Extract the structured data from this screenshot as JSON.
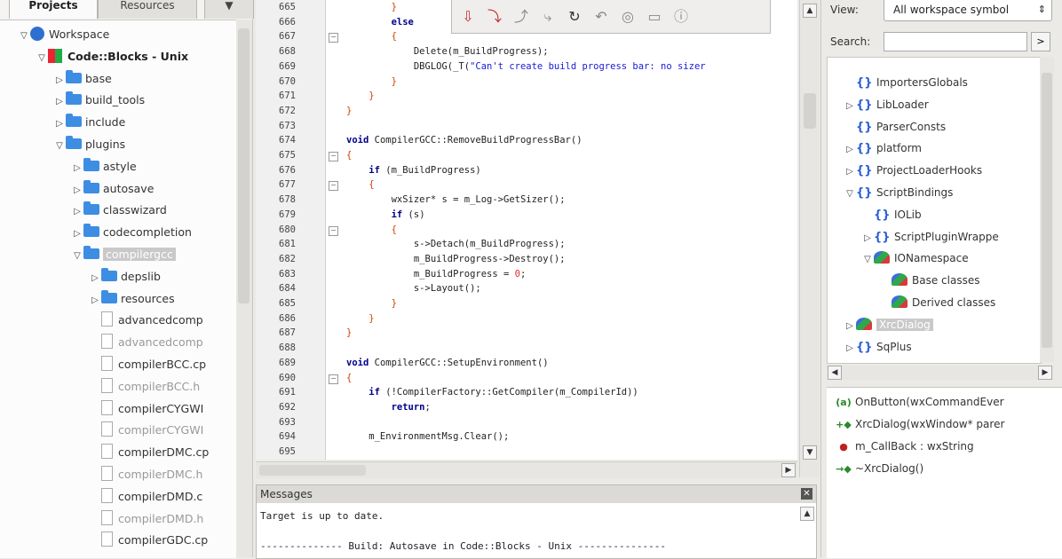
{
  "left_panel": {
    "tabs": [
      "Projects",
      "Resources"
    ],
    "tree": [
      {
        "label": "Workspace",
        "indent": 0,
        "arrow": "down",
        "icon": "workspace"
      },
      {
        "label": "Code::Blocks - Unix",
        "indent": 1,
        "arrow": "down",
        "icon": "project",
        "bold": true
      },
      {
        "label": "base",
        "indent": 2,
        "arrow": "right",
        "icon": "folder"
      },
      {
        "label": "build_tools",
        "indent": 2,
        "arrow": "right",
        "icon": "folder"
      },
      {
        "label": "include",
        "indent": 2,
        "arrow": "right",
        "icon": "folder"
      },
      {
        "label": "plugins",
        "indent": 2,
        "arrow": "down",
        "icon": "folder"
      },
      {
        "label": "astyle",
        "indent": 3,
        "arrow": "right",
        "icon": "folder"
      },
      {
        "label": "autosave",
        "indent": 3,
        "arrow": "right",
        "icon": "folder"
      },
      {
        "label": "classwizard",
        "indent": 3,
        "arrow": "right",
        "icon": "folder"
      },
      {
        "label": "codecompletion",
        "indent": 3,
        "arrow": "right",
        "icon": "folder"
      },
      {
        "label": "compilergcc",
        "indent": 3,
        "arrow": "down",
        "icon": "folder",
        "selected": true
      },
      {
        "label": "depslib",
        "indent": 4,
        "arrow": "right",
        "icon": "folder"
      },
      {
        "label": "resources",
        "indent": 4,
        "arrow": "right",
        "icon": "folder"
      },
      {
        "label": "advancedcomp",
        "indent": 4,
        "arrow": "",
        "icon": "file"
      },
      {
        "label": "advancedcomp",
        "indent": 4,
        "arrow": "",
        "icon": "file",
        "muted": true
      },
      {
        "label": "compilerBCC.cp",
        "indent": 4,
        "arrow": "",
        "icon": "file"
      },
      {
        "label": "compilerBCC.h",
        "indent": 4,
        "arrow": "",
        "icon": "file",
        "muted": true
      },
      {
        "label": "compilerCYGWI",
        "indent": 4,
        "arrow": "",
        "icon": "file"
      },
      {
        "label": "compilerCYGWI",
        "indent": 4,
        "arrow": "",
        "icon": "file",
        "muted": true
      },
      {
        "label": "compilerDMC.cp",
        "indent": 4,
        "arrow": "",
        "icon": "file"
      },
      {
        "label": "compilerDMC.h",
        "indent": 4,
        "arrow": "",
        "icon": "file",
        "muted": true
      },
      {
        "label": "compilerDMD.c",
        "indent": 4,
        "arrow": "",
        "icon": "file"
      },
      {
        "label": "compilerDMD.h",
        "indent": 4,
        "arrow": "",
        "icon": "file",
        "muted": true
      },
      {
        "label": "compilerGDC.cp",
        "indent": 4,
        "arrow": "",
        "icon": "file"
      }
    ]
  },
  "editor": {
    "lines": [
      {
        "n": "665",
        "fold": "",
        "code": [
          [
            "        ",
            ""
          ],
          [
            "}",
            "br"
          ]
        ]
      },
      {
        "n": "666",
        "fold": "",
        "code": [
          [
            "        ",
            ""
          ],
          [
            "else",
            "kw"
          ]
        ]
      },
      {
        "n": "667",
        "fold": "-",
        "code": [
          [
            "        ",
            ""
          ],
          [
            "{",
            "br"
          ]
        ]
      },
      {
        "n": "668",
        "fold": "",
        "code": [
          [
            "            Delete(m_BuildProgress);",
            ""
          ]
        ]
      },
      {
        "n": "669",
        "fold": "",
        "code": [
          [
            "            DBGLOG(_T(",
            ""
          ],
          [
            "\"Can't create build progress bar: no sizer",
            "str"
          ]
        ]
      },
      {
        "n": "670",
        "fold": "",
        "code": [
          [
            "        ",
            ""
          ],
          [
            "}",
            "br"
          ]
        ]
      },
      {
        "n": "671",
        "fold": "",
        "code": [
          [
            "    ",
            ""
          ],
          [
            "}",
            "br"
          ]
        ]
      },
      {
        "n": "672",
        "fold": "",
        "code": [
          [
            "",
            ""
          ],
          [
            "}",
            "br"
          ]
        ]
      },
      {
        "n": "673",
        "fold": "",
        "code": [
          [
            "",
            ""
          ]
        ]
      },
      {
        "n": "674",
        "fold": "",
        "code": [
          [
            "void",
            "kw"
          ],
          [
            " CompilerGCC::RemoveBuildProgressBar()",
            ""
          ]
        ]
      },
      {
        "n": "675",
        "fold": "-",
        "code": [
          [
            "{",
            "br"
          ]
        ]
      },
      {
        "n": "676",
        "fold": "",
        "code": [
          [
            "    ",
            ""
          ],
          [
            "if",
            "kw"
          ],
          [
            " (m_BuildProgress)",
            ""
          ]
        ]
      },
      {
        "n": "677",
        "fold": "-",
        "code": [
          [
            "    ",
            ""
          ],
          [
            "{",
            "br"
          ]
        ]
      },
      {
        "n": "678",
        "fold": "",
        "code": [
          [
            "        wxSizer* s = m_Log->GetSizer();",
            ""
          ]
        ]
      },
      {
        "n": "679",
        "fold": "",
        "code": [
          [
            "        ",
            ""
          ],
          [
            "if",
            "kw"
          ],
          [
            " (s)",
            ""
          ]
        ]
      },
      {
        "n": "680",
        "fold": "-",
        "code": [
          [
            "        ",
            ""
          ],
          [
            "{",
            "br"
          ]
        ]
      },
      {
        "n": "681",
        "fold": "",
        "code": [
          [
            "            s->Detach(m_BuildProgress);",
            ""
          ]
        ]
      },
      {
        "n": "682",
        "fold": "",
        "code": [
          [
            "            m_BuildProgress->Destroy();",
            ""
          ]
        ]
      },
      {
        "n": "683",
        "fold": "",
        "code": [
          [
            "            m_BuildProgress = ",
            ""
          ],
          [
            "0",
            "op"
          ],
          [
            ";",
            ""
          ]
        ]
      },
      {
        "n": "684",
        "fold": "",
        "code": [
          [
            "            s->Layout();",
            ""
          ]
        ]
      },
      {
        "n": "685",
        "fold": "",
        "code": [
          [
            "        ",
            ""
          ],
          [
            "}",
            "br"
          ]
        ]
      },
      {
        "n": "686",
        "fold": "",
        "code": [
          [
            "    ",
            ""
          ],
          [
            "}",
            "br"
          ]
        ]
      },
      {
        "n": "687",
        "fold": "",
        "code": [
          [
            "",
            ""
          ],
          [
            "}",
            "br"
          ]
        ]
      },
      {
        "n": "688",
        "fold": "",
        "code": [
          [
            "",
            ""
          ]
        ]
      },
      {
        "n": "689",
        "fold": "",
        "code": [
          [
            "void",
            "kw"
          ],
          [
            " CompilerGCC::SetupEnvironment()",
            ""
          ]
        ]
      },
      {
        "n": "690",
        "fold": "-",
        "code": [
          [
            "{",
            "br"
          ]
        ]
      },
      {
        "n": "691",
        "fold": "",
        "code": [
          [
            "    ",
            ""
          ],
          [
            "if",
            "kw"
          ],
          [
            " (!CompilerFactory::GetCompiler(m_CompilerId))",
            ""
          ]
        ]
      },
      {
        "n": "692",
        "fold": "",
        "code": [
          [
            "        ",
            ""
          ],
          [
            "return",
            "kw"
          ],
          [
            ";",
            ""
          ]
        ]
      },
      {
        "n": "693",
        "fold": "",
        "code": [
          [
            "",
            ""
          ]
        ]
      },
      {
        "n": "694",
        "fold": "",
        "code": [
          [
            "    m_EnvironmentMsg.Clear();",
            ""
          ]
        ]
      },
      {
        "n": "695",
        "fold": "",
        "code": [
          [
            "",
            ""
          ]
        ]
      }
    ]
  },
  "toolbar": {
    "icons": [
      "breakpoint-icon",
      "step-into-icon",
      "step-out-icon",
      "next-line-icon",
      "run-to-cursor-icon",
      "rewind-icon",
      "stop-icon",
      "window-icon",
      "info-icon"
    ]
  },
  "messages": {
    "title": "Messages",
    "lines": [
      "Target is up to date.",
      "-------------- Build: Autosave in Code::Blocks - Unix ---------------"
    ]
  },
  "right_panel": {
    "view_label": "View:",
    "view_value": "All workspace symbol",
    "search_label": "Search:",
    "search_value": "",
    "search_button": ">",
    "symbols": [
      {
        "label": "ImportersGlobals",
        "indent": 1,
        "arrow": "",
        "icon": "ns"
      },
      {
        "label": "LibLoader",
        "indent": 1,
        "arrow": "right",
        "icon": "ns"
      },
      {
        "label": "ParserConsts",
        "indent": 1,
        "arrow": "",
        "icon": "ns"
      },
      {
        "label": "platform",
        "indent": 1,
        "arrow": "right",
        "icon": "ns"
      },
      {
        "label": "ProjectLoaderHooks",
        "indent": 1,
        "arrow": "right",
        "icon": "ns"
      },
      {
        "label": "ScriptBindings",
        "indent": 1,
        "arrow": "down",
        "icon": "ns"
      },
      {
        "label": "IOLib",
        "indent": 2,
        "arrow": "",
        "icon": "ns"
      },
      {
        "label": "ScriptPluginWrappe",
        "indent": 2,
        "arrow": "right",
        "icon": "ns"
      },
      {
        "label": "IONamespace",
        "indent": 2,
        "arrow": "down",
        "icon": "class"
      },
      {
        "label": "Base classes",
        "indent": 3,
        "arrow": "",
        "icon": "class"
      },
      {
        "label": "Derived classes",
        "indent": 3,
        "arrow": "",
        "icon": "class"
      },
      {
        "label": "XrcDialog",
        "indent": 1,
        "arrow": "right",
        "icon": "class",
        "selected": true
      },
      {
        "label": "SqPlus",
        "indent": 1,
        "arrow": "right",
        "icon": "ns"
      }
    ],
    "members": [
      {
        "label": "OnButton(wxCommandEver",
        "icon": "(a)",
        "color": "#2a8a2a"
      },
      {
        "label": "XrcDialog(wxWindow* parer",
        "icon": "+◆",
        "color": "#2a8a2a"
      },
      {
        "label": "m_CallBack : wxString",
        "icon": "●",
        "color": "#c02020"
      },
      {
        "label": "~XrcDialog()",
        "icon": "→◆",
        "color": "#2a8a2a"
      }
    ]
  }
}
